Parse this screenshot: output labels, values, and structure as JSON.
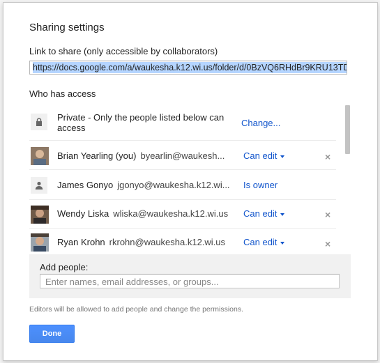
{
  "dialog": {
    "title": "Sharing settings",
    "link_label": "Link to share (only accessible by collaborators)",
    "link_value": "https://docs.google.com/a/waukesha.k12.wi.us/folder/d/0BzVQ6RHdBr9KRU13TD",
    "who_label": "Who has access",
    "privacy": {
      "icon": "lock-icon",
      "text": "Private - Only the people listed below can access",
      "change_label": "Change..."
    },
    "people": [
      {
        "name": "Brian Yearling (you)",
        "email": "byearlin@waukesh...",
        "permission": "Can edit",
        "avatar": "photo",
        "removable": true
      },
      {
        "name": "James Gonyo",
        "email": "jgonyo@waukesha.k12.wi...",
        "permission": "Is owner",
        "avatar": "person-icon",
        "removable": false
      },
      {
        "name": "Wendy Liska",
        "email": "wliska@waukesha.k12.wi.us",
        "permission": "Can edit",
        "avatar": "photo",
        "removable": true
      },
      {
        "name": "Ryan Krohn",
        "email": "rkrohn@waukesha.k12.wi.us",
        "permission": "Can edit",
        "avatar": "photo",
        "removable": true
      }
    ],
    "remove_glyph": "×",
    "add_people": {
      "label": "Add people:",
      "placeholder": "Enter names, email addresses, or groups..."
    },
    "note": "Editors will be allowed to add people and change the permissions.",
    "done_label": "Done",
    "colors": {
      "link": "#1155cc",
      "primary_button": "#4d90fe",
      "selection": "#b5d5ff"
    }
  }
}
